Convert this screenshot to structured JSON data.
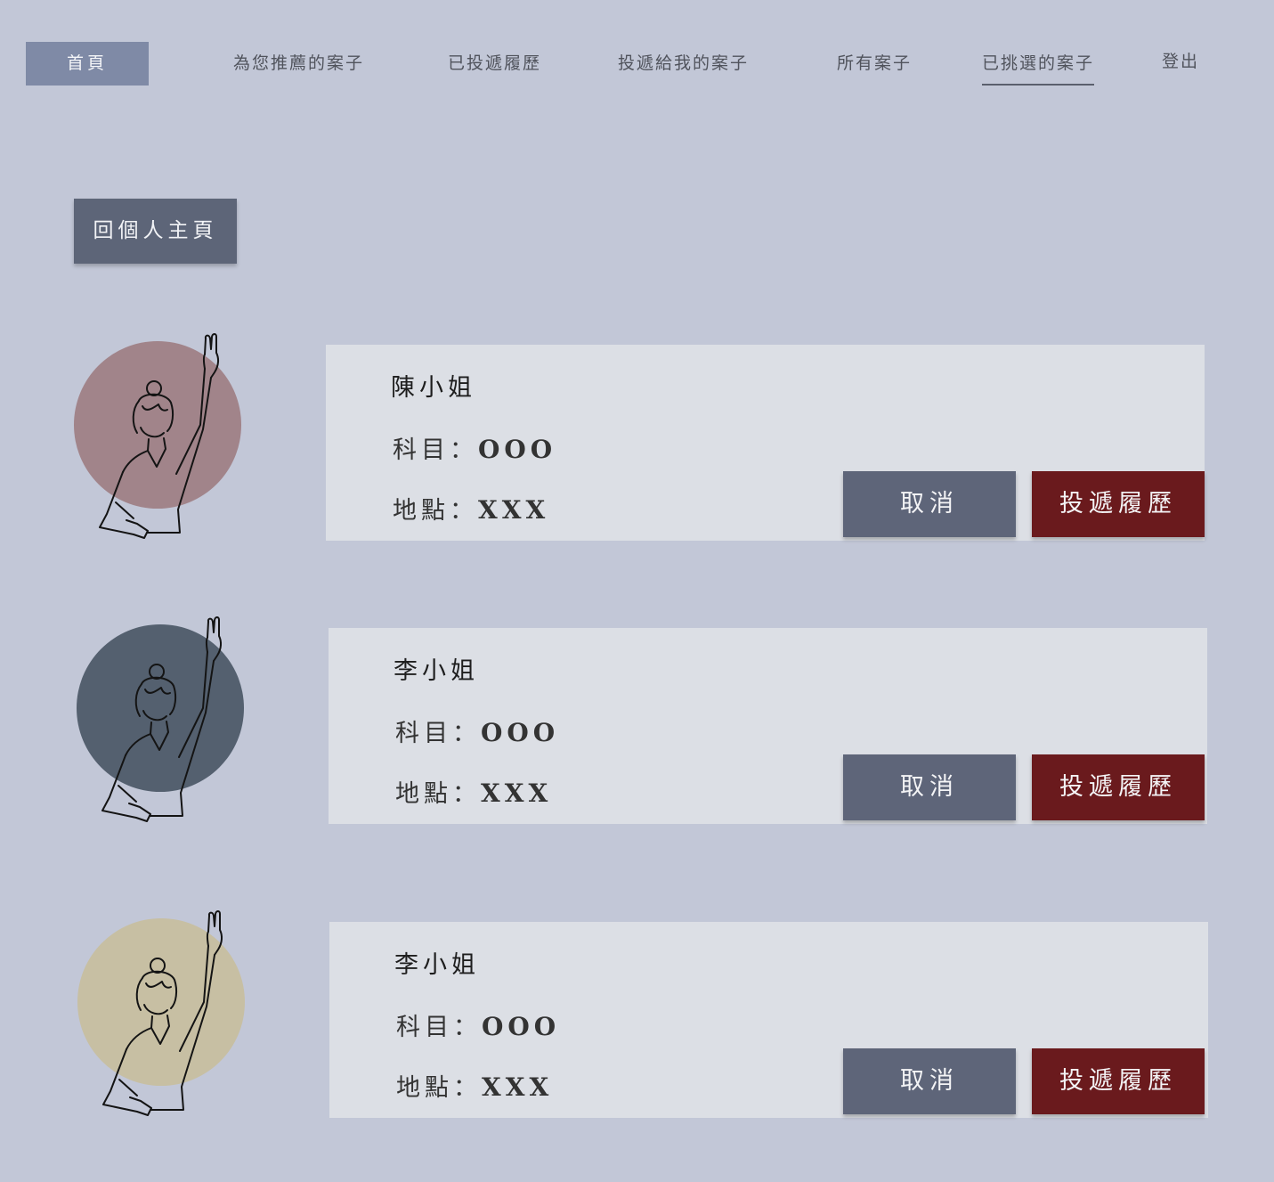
{
  "nav": {
    "home": "首頁",
    "recommended": "為您推薦的案子",
    "submitted": "已投遞履歷",
    "received": "投遞給我的案子",
    "all": "所有案子",
    "selected": "已挑選的案子",
    "logout": "登出"
  },
  "back_button": "回個人主頁",
  "buttons": {
    "cancel": "取消",
    "apply": "投遞履歷"
  },
  "cards": [
    {
      "name": "陳小姐",
      "subject_label": "科目：",
      "subject_value": "OOO",
      "place_label": "地點：",
      "place_value": "XXX",
      "avatar_color": "#a1848a"
    },
    {
      "name": "李小姐",
      "subject_label": "科目：",
      "subject_value": "OOO",
      "place_label": "地點：",
      "place_value": "XXX",
      "avatar_color": "#54606f"
    },
    {
      "name": "李小姐",
      "subject_label": "科目：",
      "subject_value": "OOO",
      "place_label": "地點：",
      "place_value": "XXX",
      "avatar_color": "#c7bfa3"
    }
  ],
  "icons": {
    "avatar": "person-raising-hand-icon"
  }
}
